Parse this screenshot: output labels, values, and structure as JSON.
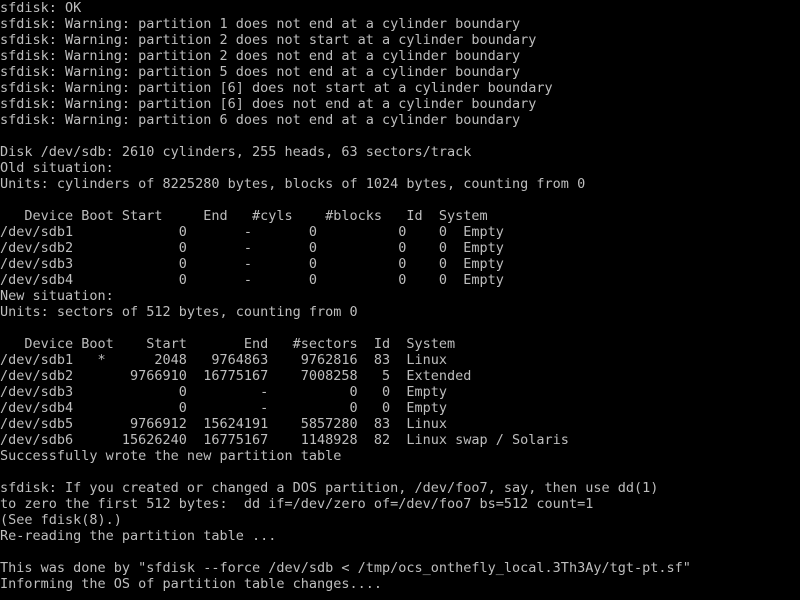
{
  "terminal": {
    "title": "sfdisk terminal output",
    "foreground_color": "#bebebe",
    "background_color": "#000000",
    "columns": 98,
    "rows": 37,
    "lines": [
      "sfdisk: OK",
      "sfdisk: Warning: partition 1 does not end at a cylinder boundary",
      "sfdisk: Warning: partition 2 does not start at a cylinder boundary",
      "sfdisk: Warning: partition 2 does not end at a cylinder boundary",
      "sfdisk: Warning: partition 5 does not end at a cylinder boundary",
      "sfdisk: Warning: partition [6] does not start at a cylinder boundary",
      "sfdisk: Warning: partition [6] does not end at a cylinder boundary",
      "sfdisk: Warning: partition 6 does not end at a cylinder boundary",
      "",
      "Disk /dev/sdb: 2610 cylinders, 255 heads, 63 sectors/track",
      "Old situation:",
      "Units: cylinders of 8225280 bytes, blocks of 1024 bytes, counting from 0",
      "",
      "   Device Boot Start     End   #cyls    #blocks   Id  System",
      "/dev/sdb1             0       -       0          0    0  Empty",
      "/dev/sdb2             0       -       0          0    0  Empty",
      "/dev/sdb3             0       -       0          0    0  Empty",
      "/dev/sdb4             0       -       0          0    0  Empty",
      "New situation:",
      "Units: sectors of 512 bytes, counting from 0",
      "",
      "   Device Boot    Start       End   #sectors  Id  System",
      "/dev/sdb1   *      2048   9764863    9762816  83  Linux",
      "/dev/sdb2       9766910  16775167    7008258   5  Extended",
      "/dev/sdb3             0         -          0   0  Empty",
      "/dev/sdb4             0         -          0   0  Empty",
      "/dev/sdb5       9766912  15624191    5857280  83  Linux",
      "/dev/sdb6      15626240  16775167    1148928  82  Linux swap / Solaris",
      "Successfully wrote the new partition table",
      "",
      "sfdisk: If you created or changed a DOS partition, /dev/foo7, say, then use dd(1)",
      "to zero the first 512 bytes:  dd if=/dev/zero of=/dev/foo7 bs=512 count=1",
      "(See fdisk(8).)",
      "Re-reading the partition table ...",
      "",
      "This was done by \"sfdisk --force /dev/sdb < /tmp/ocs_onthefly_local.3Th3Ay/tgt-pt.sf\"",
      "Informing the OS of partition table changes...."
    ]
  },
  "disk": {
    "device": "/dev/sdb",
    "cylinders": 2610,
    "heads": 255,
    "sectors_per_track": 63
  },
  "old_situation": {
    "units": "cylinders of 8225280 bytes, blocks of 1024 bytes, counting from 0",
    "headers": [
      "Device",
      "Boot",
      "Start",
      "End",
      "#cyls",
      "#blocks",
      "Id",
      "System"
    ],
    "rows": [
      {
        "device": "/dev/sdb1",
        "boot": "",
        "start": "0",
        "end": "-",
        "cyls": "0",
        "blocks": "0",
        "id": "0",
        "system": "Empty"
      },
      {
        "device": "/dev/sdb2",
        "boot": "",
        "start": "0",
        "end": "-",
        "cyls": "0",
        "blocks": "0",
        "id": "0",
        "system": "Empty"
      },
      {
        "device": "/dev/sdb3",
        "boot": "",
        "start": "0",
        "end": "-",
        "cyls": "0",
        "blocks": "0",
        "id": "0",
        "system": "Empty"
      },
      {
        "device": "/dev/sdb4",
        "boot": "",
        "start": "0",
        "end": "-",
        "cyls": "0",
        "blocks": "0",
        "id": "0",
        "system": "Empty"
      }
    ]
  },
  "new_situation": {
    "units": "sectors of 512 bytes, counting from 0",
    "headers": [
      "Device",
      "Boot",
      "Start",
      "End",
      "#sectors",
      "Id",
      "System"
    ],
    "rows": [
      {
        "device": "/dev/sdb1",
        "boot": "*",
        "start": "2048",
        "end": "9764863",
        "sectors": "9762816",
        "id": "83",
        "system": "Linux"
      },
      {
        "device": "/dev/sdb2",
        "boot": "",
        "start": "9766910",
        "end": "16775167",
        "sectors": "7008258",
        "id": "5",
        "system": "Extended"
      },
      {
        "device": "/dev/sdb3",
        "boot": "",
        "start": "0",
        "end": "-",
        "sectors": "0",
        "id": "0",
        "system": "Empty"
      },
      {
        "device": "/dev/sdb4",
        "boot": "",
        "start": "0",
        "end": "-",
        "sectors": "0",
        "id": "0",
        "system": "Empty"
      },
      {
        "device": "/dev/sdb5",
        "boot": "",
        "start": "9766912",
        "end": "15624191",
        "sectors": "5857280",
        "id": "83",
        "system": "Linux"
      },
      {
        "device": "/dev/sdb6",
        "boot": "",
        "start": "15626240",
        "end": "16775167",
        "sectors": "1148928",
        "id": "82",
        "system": "Linux swap / Solaris"
      }
    ],
    "status": "Successfully wrote the new partition table"
  },
  "footer": {
    "hint_line_1": "sfdisk: If you created or changed a DOS partition, /dev/foo7, say, then use dd(1)",
    "hint_line_2": "to zero the first 512 bytes:  dd if=/dev/zero of=/dev/foo7 bs=512 count=1",
    "hint_line_3": "(See fdisk(8).)",
    "rereading": "Re-reading the partition table ...",
    "command": "This was done by \"sfdisk --force /dev/sdb < /tmp/ocs_onthefly_local.3Th3Ay/tgt-pt.sf\"",
    "informing": "Informing the OS of partition table changes...."
  }
}
